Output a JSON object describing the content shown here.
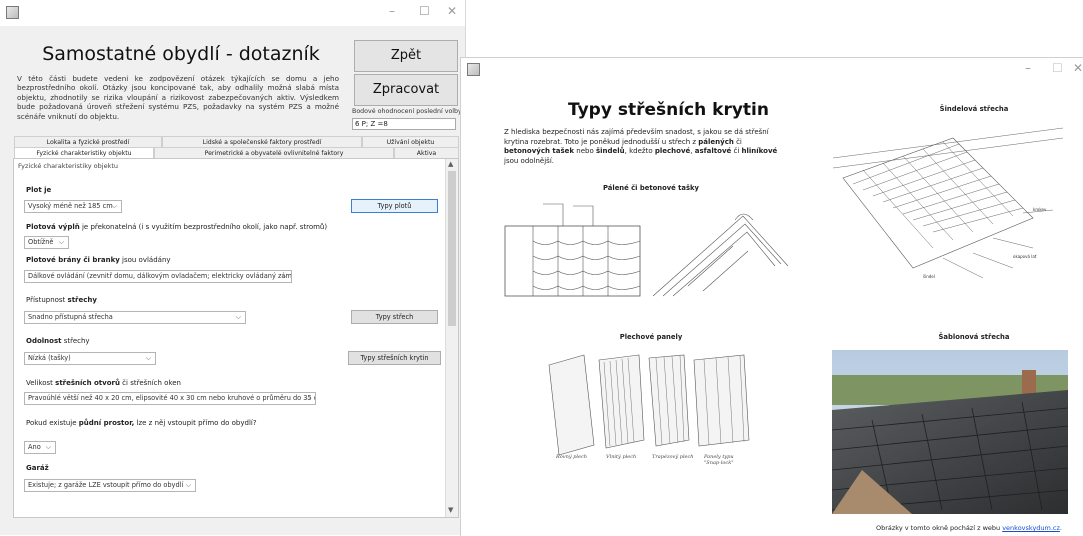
{
  "form_window": {
    "title": "Samostatné obydlí - dotazník",
    "intro": "V této části budete vedeni ke zodpovězení otázek týkajících se domu a jeho bezprostředního okolí. Otázky jsou koncipované tak, aby odhalily možná slabá místa objektu, zhodnotily se rizika vloupání a rizikovost zabezpečovaných aktiv. Výsledkem bude požadovaná úroveň střežení systému PZS, požadavky na systém PZS a možné scénáře vniknutí do objektu.",
    "back_button": "Zpět",
    "process_button": "Zpracovat",
    "score_label": "Bodové ohodnocení poslední volby",
    "score_value": "6 P; Z =8",
    "minimize": "–",
    "maximize": "☐",
    "close": "✕",
    "tabs_row1": [
      "Lokalita a fyzické prostředí",
      "Lidské a společenské faktory prostředí",
      "Užívání objektu"
    ],
    "tabs_row2": [
      "Fyzické charakteristiky objektu",
      "Perimetrické a obyvatelé ovlivnitelné faktory",
      "Aktiva"
    ],
    "panel_caption": "Fyzické charakteristiky objektu",
    "questions": {
      "q1_bold": "Plot je",
      "q1_value": "Vysoký méně než 185 cm",
      "q1_button": "Typy plotů",
      "q2_bold": "Plotová výplň",
      "q2_rest": " je překonatelná (i s využitím bezprostředního okolí, jako např. stromů)",
      "q2_value": "Obtížně",
      "q3_bold": "Plotové brány či branky",
      "q3_rest": " jsou ovládány",
      "q3_value": "Dálkové ovládání (zevnitř domu, dálkovým ovladačem; elektricky ovládaný zámek)",
      "q4_pre": "Přístupnost ",
      "q4_bold": "střechy",
      "q4_value": "Snadno přístupná střecha",
      "q4_button": "Typy střech",
      "q5_bold": "Odolnost",
      "q5_rest": " střechy",
      "q5_value": "Nízká (tašky)",
      "q5_button": "Typy střešních krytin",
      "q6_pre": "Velikost ",
      "q6_bold": "střešních otvorů",
      "q6_rest": " či střešních oken",
      "q6_value": "Pravoúhlé větší než 40 x 20 cm, elipsovité 40 x 30 cm nebo kruhové o průměru do 35 cm",
      "q7_pre": "Pokud existuje ",
      "q7_bold": "půdní prostor,",
      "q7_rest": " lze z něj vstoupit přímo do obydlí?",
      "q7_value": "Ano",
      "q8_bold": "Garáž",
      "q8_value": "Existuje; z garáže LZE vstoupit přímo do obydlí"
    }
  },
  "info_window": {
    "title": "Typy střešních krytin",
    "intro_1": "Z hlediska bezpečnosti nás zajímá především snadost, s jakou se dá střešní krytina rozebrat. Toto je poněkud jednodušší u střech z ",
    "intro_b1": "pálených",
    "intro_2": " či ",
    "intro_b2": "betonových tašek",
    "intro_3": " nebo ",
    "intro_b3": "šindelů",
    "intro_4": ", kdežto ",
    "intro_b4": "plechové",
    "intro_5": ", ",
    "intro_b5": "asfaltové",
    "intro_6": " či ",
    "intro_b6": "hliníkové",
    "intro_7": " jsou odolnější.",
    "cap_tiles": "Pálené či betonové tašky",
    "cap_shingle": "Šindelová střecha",
    "cap_panels": "Plechové panely",
    "cap_template": "Šablonová střecha",
    "panel_labels": [
      "Rovný plech",
      "Vlnitý plech",
      "Trapézový plech",
      "Panely typu \"Snap-lock\""
    ],
    "footer_text": "Obrázky v tomto okně pochází z webu ",
    "footer_link": "venkovskydum.cz",
    "footer_end": ".",
    "minimize": "–",
    "maximize": "☐",
    "close": "✕"
  }
}
